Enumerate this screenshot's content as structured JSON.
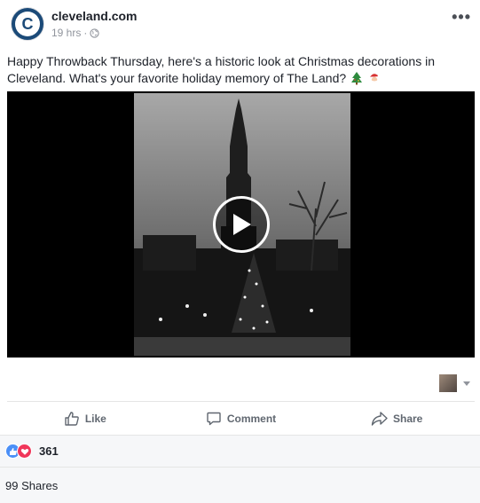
{
  "post": {
    "page_name": "cleveland.com",
    "avatar_letter": "C",
    "timestamp": "19 hrs",
    "meta_separator": "·",
    "text_line1": "Happy Throwback Thursday, here's a historic look at Christmas decorations in",
    "text_line2": "Cleveland. What's your favorite holiday memory of The Land?",
    "icons": [
      "globe-icon",
      "more-options-icon",
      "christmas-tree-emoji",
      "santa-emoji",
      "play-icon"
    ]
  },
  "actions": {
    "like_label": "Like",
    "comment_label": "Comment",
    "share_label": "Share"
  },
  "reactions": {
    "count": "361",
    "types": [
      "like",
      "love"
    ],
    "colors": {
      "like": "#4a8ff7",
      "love": "#f0365a"
    }
  },
  "shares": {
    "label": "99 Shares"
  },
  "colors": {
    "brand": "#1b4a78",
    "text": "#1d2129",
    "muted": "#90949c",
    "action_text": "#606770",
    "footer_bg": "#f6f7f9"
  }
}
